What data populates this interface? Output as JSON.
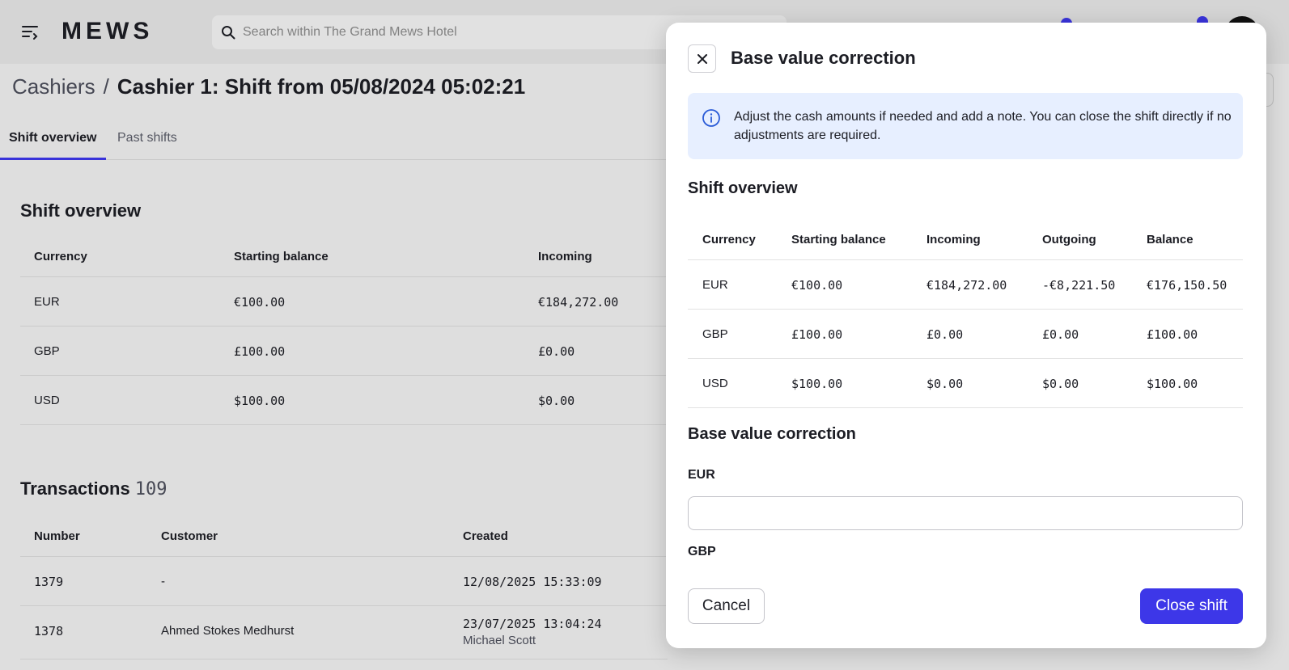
{
  "app": {
    "logo": "MEWS"
  },
  "search": {
    "placeholder": "Search within The Grand Mews Hotel"
  },
  "breadcrumb": {
    "parent": "Cashiers",
    "separator": "/",
    "current": "Cashier 1: Shift from 05/08/2024 05:02:21"
  },
  "tabs": [
    {
      "label": "Shift overview",
      "active": true
    },
    {
      "label": "Past shifts",
      "active": false
    }
  ],
  "shift_overview": {
    "title": "Shift overview",
    "columns": [
      "Currency",
      "Starting balance",
      "Incoming"
    ],
    "rows": [
      {
        "currency": "EUR",
        "starting": "€100.00",
        "incoming": "€184,272.00"
      },
      {
        "currency": "GBP",
        "starting": "£100.00",
        "incoming": "£0.00"
      },
      {
        "currency": "USD",
        "starting": "$100.00",
        "incoming": "$0.00"
      }
    ]
  },
  "transactions": {
    "title": "Transactions",
    "count": "109",
    "columns": [
      "Number",
      "Customer",
      "Created"
    ],
    "rows": [
      {
        "number": "1379",
        "customer": "-",
        "created": "12/08/2025 15:33:09",
        "created_by": ""
      },
      {
        "number": "1378",
        "customer": "Ahmed Stokes Medhurst",
        "created": "23/07/2025 13:04:24",
        "created_by": "Michael Scott"
      }
    ]
  },
  "modal": {
    "title": "Base value correction",
    "info": "Adjust the cash amounts if needed and add a note. You can close the shift directly if no adjustments are required.",
    "overview_title": "Shift overview",
    "columns": [
      "Currency",
      "Starting balance",
      "Incoming",
      "Outgoing",
      "Balance"
    ],
    "rows": [
      {
        "currency": "EUR",
        "starting": "€100.00",
        "incoming": "€184,272.00",
        "outgoing": "-€8,221.50",
        "balance": "€176,150.50"
      },
      {
        "currency": "GBP",
        "starting": "£100.00",
        "incoming": "£0.00",
        "outgoing": "£0.00",
        "balance": "£100.00"
      },
      {
        "currency": "USD",
        "starting": "$100.00",
        "incoming": "$0.00",
        "outgoing": "$0.00",
        "balance": "$100.00"
      }
    ],
    "correction_title": "Base value correction",
    "fields": [
      {
        "label": "EUR",
        "value": ""
      },
      {
        "label": "GBP"
      }
    ],
    "cancel_label": "Cancel",
    "submit_label": "Close shift"
  },
  "colors": {
    "accent": "#3d37e8",
    "info_bg": "#e7efff"
  }
}
